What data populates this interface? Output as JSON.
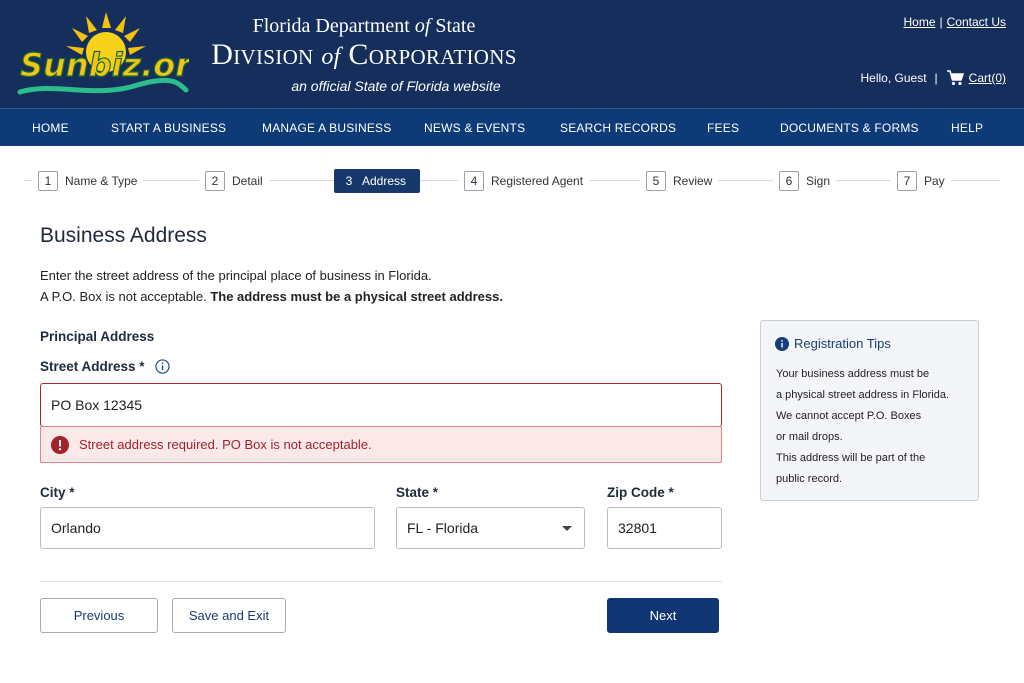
{
  "header": {
    "logo_text": "Sunbiz.org",
    "dept_pre": "Florida Department ",
    "dept_of": "of",
    "dept_post": " State",
    "division_pre": "Division ",
    "division_of": "of",
    "division_post": " Corporations",
    "official": "an official State of Florida website",
    "links": {
      "home": "Home",
      "separator": "|",
      "contact": "Contact Us"
    },
    "greeting": "Hello, Guest",
    "cart": "Cart(0)"
  },
  "nav": [
    "HOME",
    "START A BUSINESS",
    "MANAGE A BUSINESS",
    "NEWS & EVENTS",
    "SEARCH RECORDS",
    "FEES",
    "DOCUMENTS & FORMS",
    "HELP"
  ],
  "steps": [
    {
      "num": "1",
      "label": "Name & Type"
    },
    {
      "num": "2",
      "label": "Detail"
    },
    {
      "num": "3",
      "label": "Address",
      "active": true
    },
    {
      "num": "4",
      "label": "Registered Agent"
    },
    {
      "num": "5",
      "label": "Review"
    },
    {
      "num": "6",
      "label": "Sign"
    },
    {
      "num": "7",
      "label": "Pay"
    }
  ],
  "form": {
    "title": "Business Address",
    "intro_line1": "Enter the street address of the principal place of business in Florida.",
    "intro_line2_plain": "A P.O. Box is not acceptable. ",
    "intro_line2_bold": "The address must be a physical street address.",
    "section": "Principal Address",
    "street_label": "Street Address *",
    "street_value": "PO Box 12345",
    "error_message": "Street address required. PO Box is not acceptable.",
    "city_label": "City *",
    "city_value": "Orlando",
    "state_label": "State *",
    "state_value": "FL - Florida",
    "zip_label": "Zip Code *",
    "zip_value": "32801",
    "buttons": {
      "previous": "Previous",
      "save_exit": "Save and Exit",
      "next": "Next"
    }
  },
  "tips": {
    "title": "Registration Tips",
    "lines": [
      "Your business address must be",
      "a physical street address in Florida.",
      "We cannot accept P.O. Boxes",
      "or mail drops.",
      "This address will be part of the",
      "public record."
    ]
  },
  "colors": {
    "header_bg": "#152e5c",
    "nav_bg": "#0e3a78",
    "primary": "#0f3672",
    "error": "#b3262e",
    "error_bg": "#fbe9ea"
  }
}
